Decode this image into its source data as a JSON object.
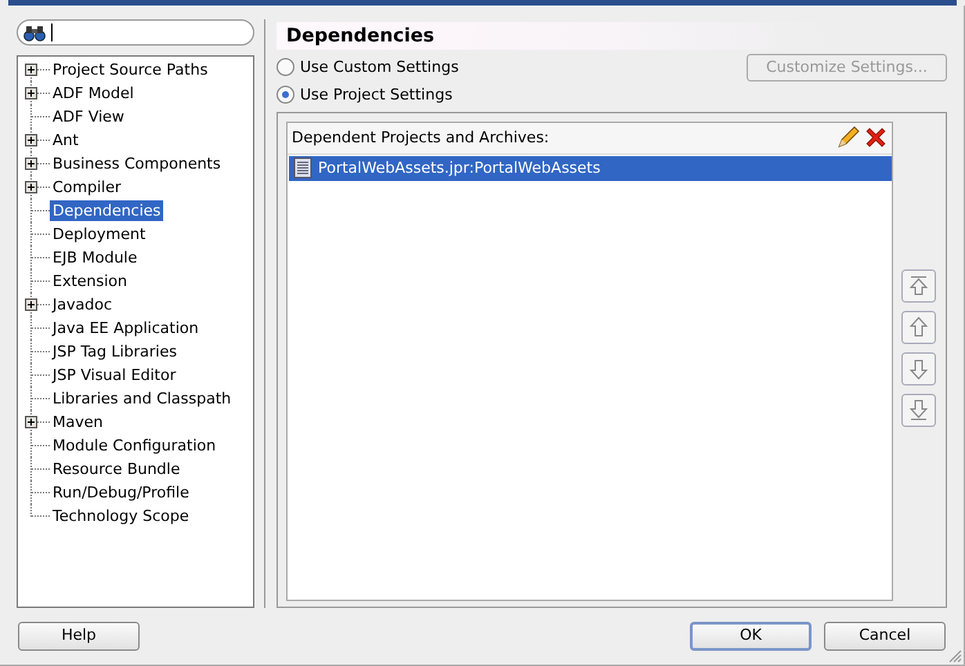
{
  "tree": {
    "items": [
      {
        "label": "Project Source Paths",
        "kind": "folder",
        "selected": false
      },
      {
        "label": "ADF Model",
        "kind": "folder",
        "selected": false
      },
      {
        "label": "ADF View",
        "kind": "leaf",
        "selected": false
      },
      {
        "label": "Ant",
        "kind": "folder",
        "selected": false
      },
      {
        "label": "Business Components",
        "kind": "folder",
        "selected": false
      },
      {
        "label": "Compiler",
        "kind": "folder",
        "selected": false
      },
      {
        "label": "Dependencies",
        "kind": "leaf",
        "selected": true
      },
      {
        "label": "Deployment",
        "kind": "leaf",
        "selected": false
      },
      {
        "label": "EJB Module",
        "kind": "leaf",
        "selected": false
      },
      {
        "label": "Extension",
        "kind": "leaf",
        "selected": false
      },
      {
        "label": "Javadoc",
        "kind": "folder",
        "selected": false
      },
      {
        "label": "Java EE Application",
        "kind": "leaf",
        "selected": false
      },
      {
        "label": "JSP Tag Libraries",
        "kind": "leaf",
        "selected": false
      },
      {
        "label": "JSP Visual Editor",
        "kind": "leaf",
        "selected": false
      },
      {
        "label": "Libraries and Classpath",
        "kind": "leaf",
        "selected": false
      },
      {
        "label": "Maven",
        "kind": "folder",
        "selected": false
      },
      {
        "label": "Module Configuration",
        "kind": "leaf",
        "selected": false
      },
      {
        "label": "Resource Bundle",
        "kind": "leaf",
        "selected": false
      },
      {
        "label": "Run/Debug/Profile",
        "kind": "leaf",
        "selected": false
      },
      {
        "label": "Technology Scope",
        "kind": "leaf",
        "selected": false
      }
    ]
  },
  "panel": {
    "title": "Dependencies",
    "options": [
      {
        "label": "Use Custom Settings",
        "selected": false
      },
      {
        "label": "Use Project Settings",
        "selected": true
      }
    ],
    "customize_button": {
      "label": "Customize Settings...",
      "disabled": true
    },
    "list": {
      "header": "Dependent Projects and Archives:",
      "rows": [
        {
          "label": "PortalWebAssets.jpr:PortalWebAssets",
          "selected": true
        }
      ]
    }
  },
  "buttons": [
    {
      "label": "Help",
      "default": false
    },
    {
      "label": "OK",
      "default": true
    },
    {
      "label": "Cancel",
      "default": false
    }
  ]
}
